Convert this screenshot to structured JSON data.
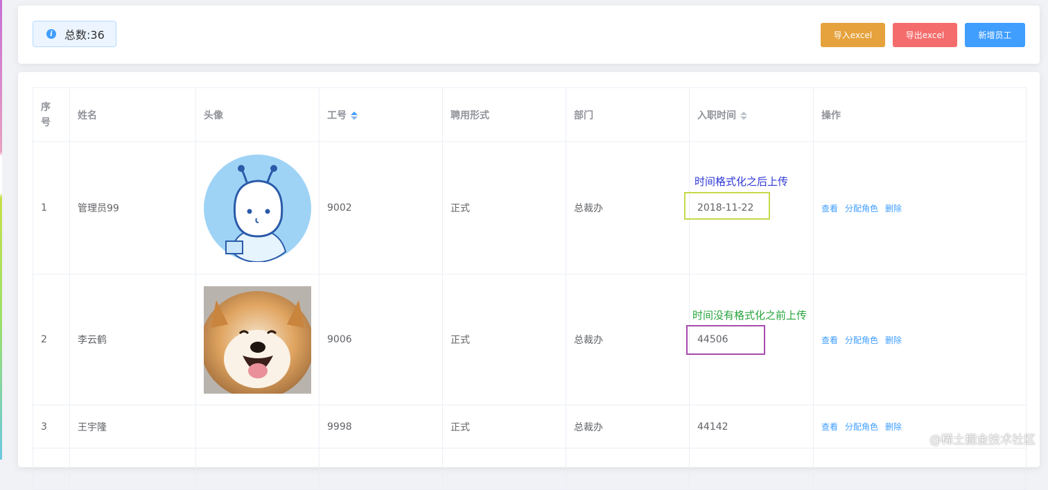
{
  "header": {
    "total_label": "总数:36",
    "buttons": {
      "import": "导入excel",
      "export": "导出excel",
      "add": "新增员工"
    }
  },
  "table": {
    "columns": {
      "index": "序号",
      "name": "姓名",
      "avatar": "头像",
      "work_number": "工号",
      "form_of_employment": "聘用形式",
      "department": "部门",
      "time_of_entry": "入职时间",
      "actions": "操作"
    },
    "rows": [
      {
        "index": "1",
        "name": "管理员99",
        "avatar": "cartoon-avatar",
        "work_number": "9002",
        "form_of_employment": "正式",
        "department": "总裁办",
        "time_of_entry": "2018-11-22"
      },
      {
        "index": "2",
        "name": "李云鹤",
        "avatar": "dog-photo",
        "work_number": "9006",
        "form_of_employment": "正式",
        "department": "总裁办",
        "time_of_entry": "44506"
      },
      {
        "index": "3",
        "name": "王宇隆",
        "avatar": "",
        "work_number": "9998",
        "form_of_employment": "正式",
        "department": "总裁办",
        "time_of_entry": "44142"
      }
    ],
    "action_labels": {
      "view": "查看",
      "assign_role": "分配角色",
      "delete": "删除"
    }
  },
  "annotations": {
    "formatted": "时间格式化之后上传",
    "unformatted": "时间没有格式化之前上传"
  },
  "watermark": "@稀土掘金技术社区",
  "colors": {
    "primary": "#409eff",
    "warning": "#e6a23c",
    "danger": "#f56c6c",
    "annotation_blue": "#2e36d6",
    "annotation_green": "#27a33c",
    "box_yellow_green": "#c6d84a",
    "box_purple": "#a64bb0"
  }
}
